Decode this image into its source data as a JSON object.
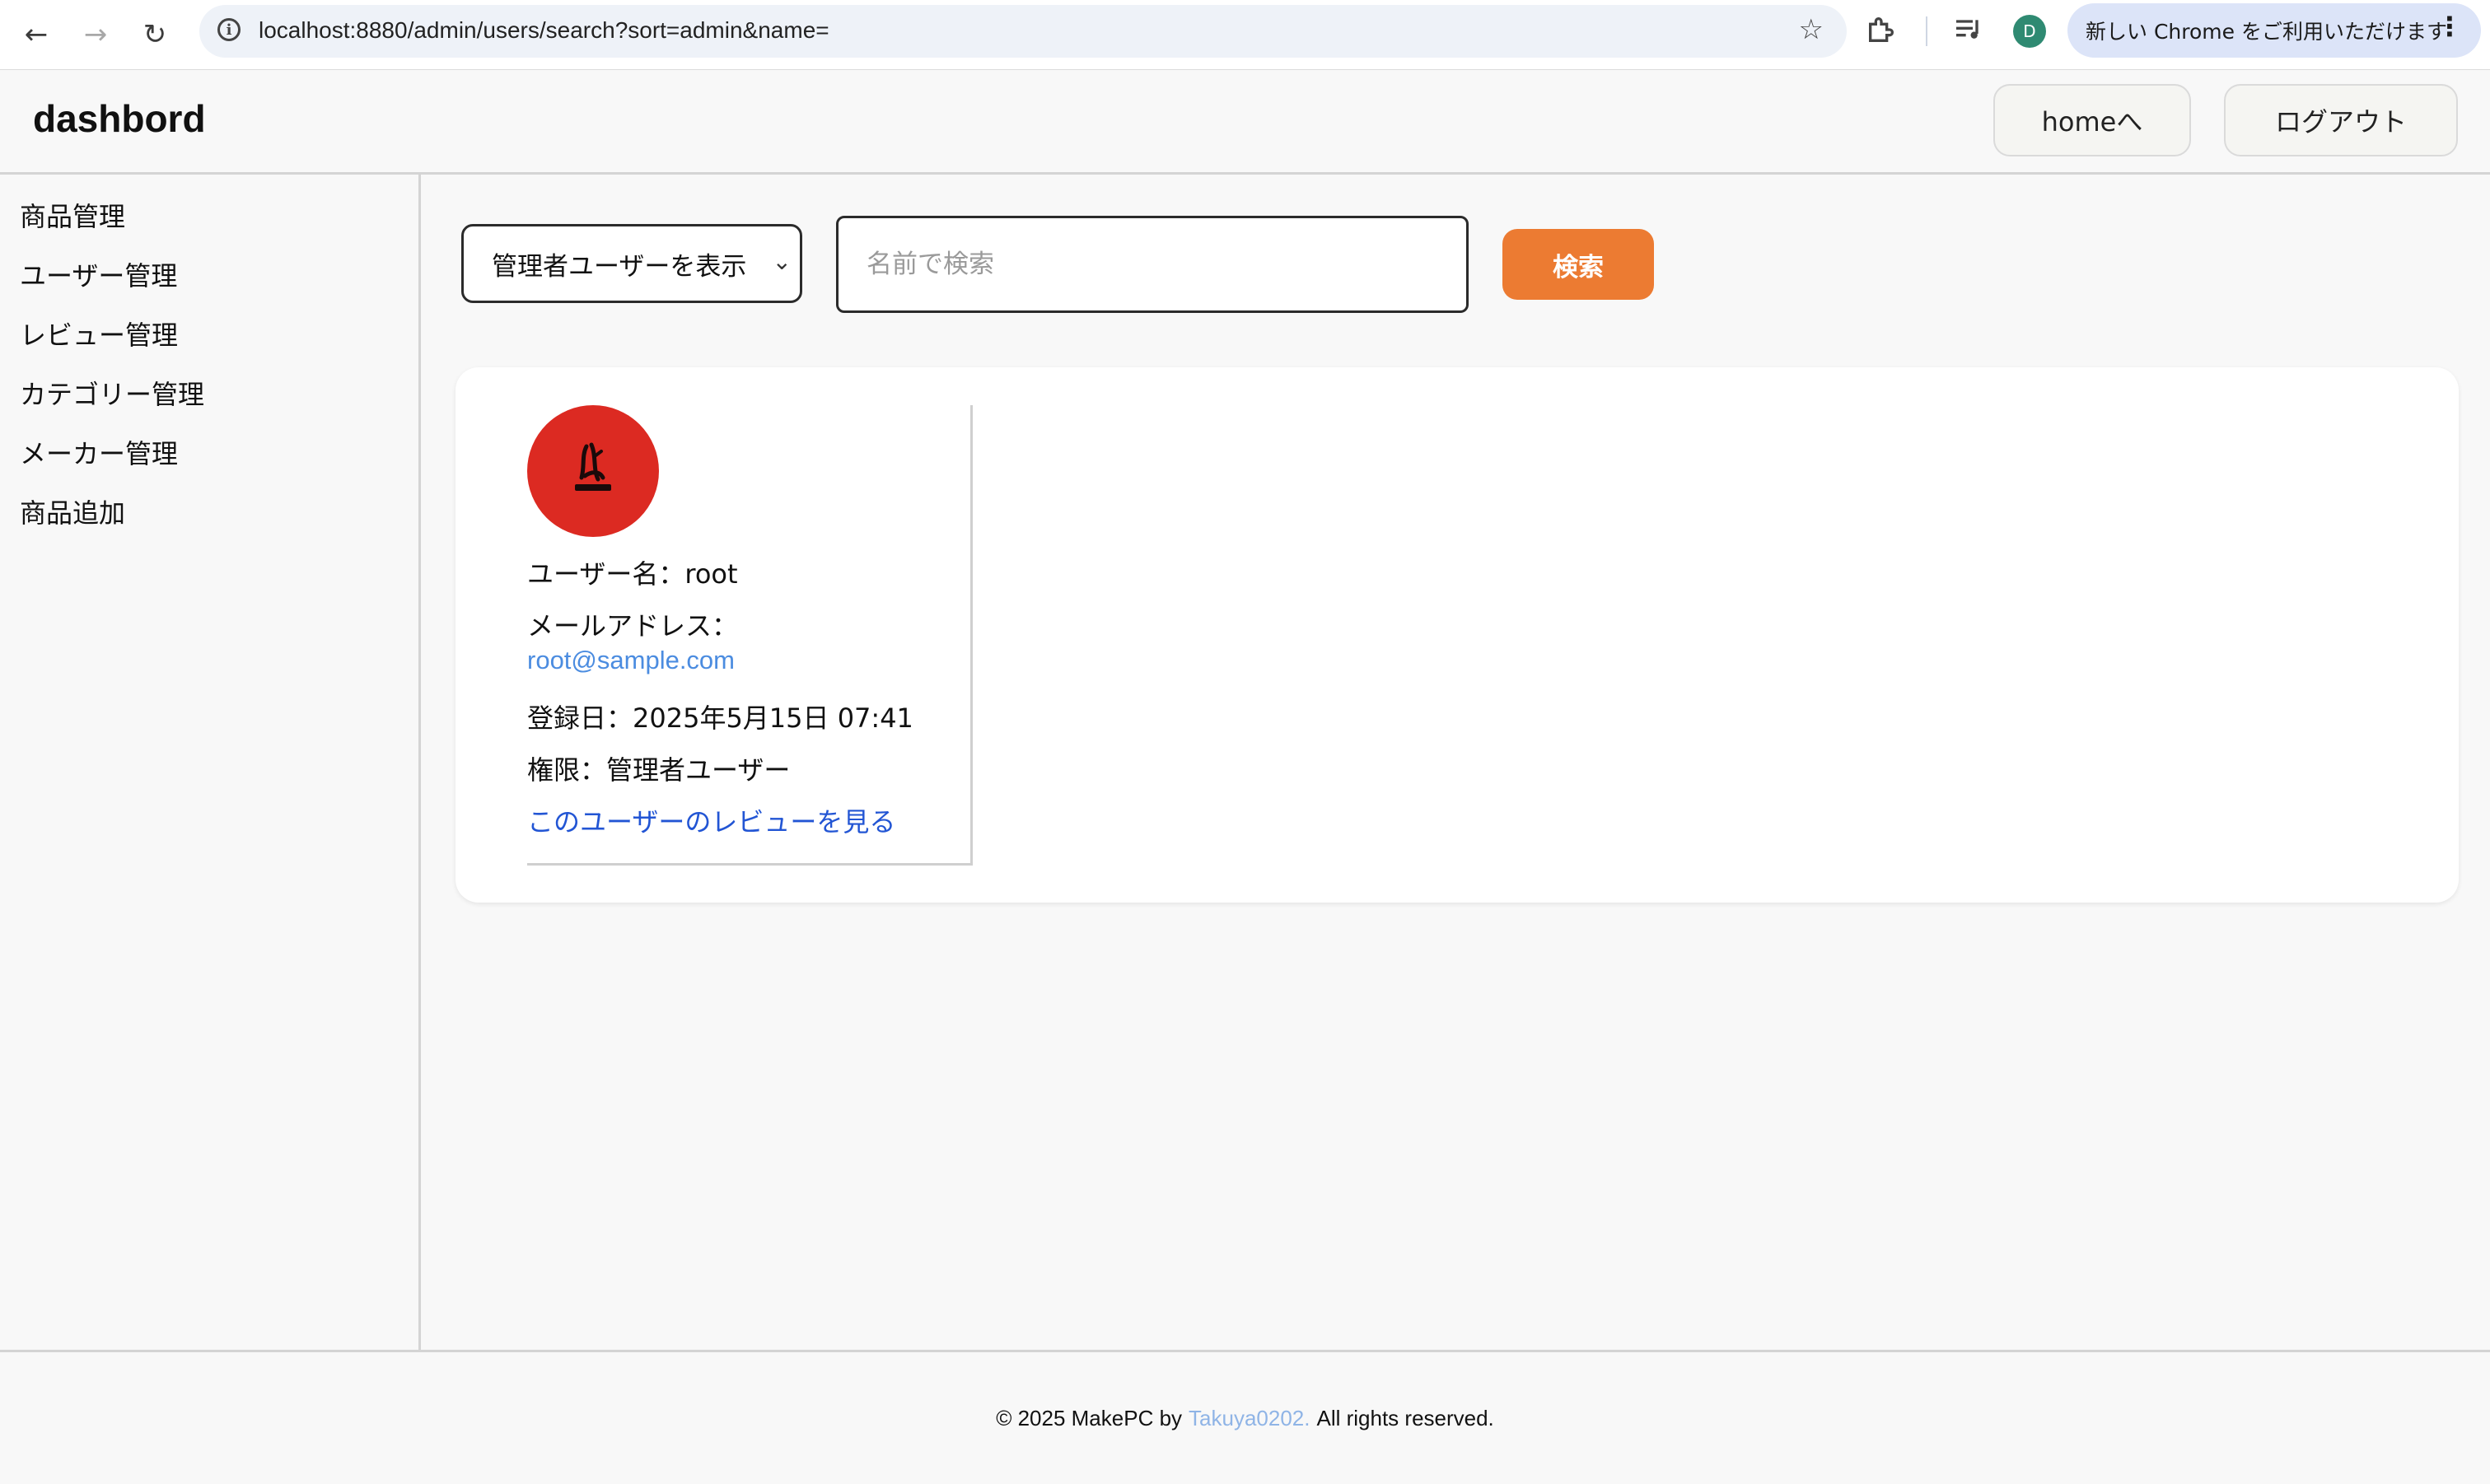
{
  "browser": {
    "url": "localhost:8880/admin/users/search?sort=admin&name=",
    "profile_initial": "D",
    "update_label": "新しい Chrome をご利用いただけます"
  },
  "header": {
    "brand": "dashbord",
    "home_button": "homeへ",
    "logout_button": "ログアウト"
  },
  "sidebar": {
    "items": [
      {
        "label": "商品管理"
      },
      {
        "label": "ユーザー管理"
      },
      {
        "label": "レビュー管理"
      },
      {
        "label": "カテゴリー管理"
      },
      {
        "label": "メーカー管理"
      },
      {
        "label": "商品追加"
      }
    ]
  },
  "search": {
    "filter_selected": "管理者ユーザーを表示",
    "name_value": "",
    "name_placeholder": "名前で検索",
    "submit_label": "検索"
  },
  "user": {
    "name_line": "ユーザー名：root",
    "email_label": "メールアドレス：",
    "email": "root@sample.com",
    "registered_line": "登録日：2025年5月15日 07:41",
    "role_line": "権限：管理者ユーザー",
    "reviews_link": "このユーザーのレビューを見る",
    "avatar_color": "#dc2a22"
  },
  "footer": {
    "prefix": "© 2025 MakePC by",
    "author": "Takuya0202.",
    "suffix": "All rights reserved."
  },
  "colors": {
    "accent": "#ec7b32",
    "link": "#2255d4",
    "email": "#4b8ce0"
  }
}
